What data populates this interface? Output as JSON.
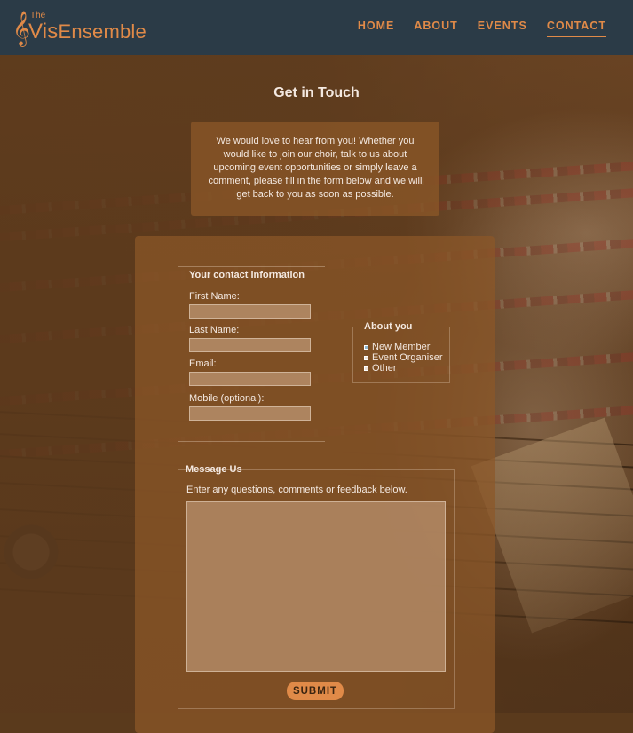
{
  "header": {
    "logo": {
      "the": "The",
      "vis": "Vis",
      "ensemble": "Ensemble"
    },
    "nav": [
      {
        "label": "HOME"
      },
      {
        "label": "ABOUT"
      },
      {
        "label": "EVENTS"
      },
      {
        "label": "CONTACT",
        "active": true
      }
    ]
  },
  "page": {
    "title": "Get in Touch",
    "intro": "We would love to hear from you! Whether you would like to join our choir, talk to us about upcoming event opportunities or simply leave a comment, please fill in the form below and we will get back to you as soon as possible."
  },
  "form": {
    "contact_legend": "Your contact information",
    "fields": [
      {
        "label": "First Name:",
        "value": ""
      },
      {
        "label": "Last Name:",
        "value": ""
      },
      {
        "label": "Email:",
        "value": ""
      },
      {
        "label": "Mobile (optional):",
        "value": ""
      }
    ],
    "about": {
      "legend": "About you",
      "options": [
        {
          "label": "New Member",
          "selected": true
        },
        {
          "label": "Event Organiser",
          "selected": false
        },
        {
          "label": "Other",
          "selected": false
        }
      ]
    },
    "message": {
      "legend": "Message Us",
      "hint": "Enter any questions, comments or feedback below.",
      "value": ""
    },
    "submit_label": "SUBMIT"
  },
  "colors": {
    "accent": "#e08a48",
    "header_bg": "#2b3b47",
    "panel": "#8c5828"
  }
}
